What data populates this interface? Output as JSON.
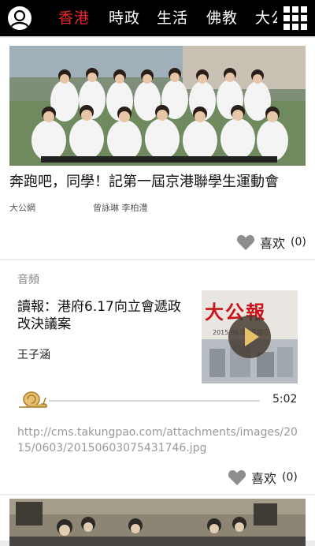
{
  "nav": {
    "tabs": [
      {
        "label": "香港",
        "active": true
      },
      {
        "label": "時政",
        "active": false
      },
      {
        "label": "生活",
        "active": false
      },
      {
        "label": "佛教",
        "active": false
      },
      {
        "label": "大公",
        "active": false
      }
    ],
    "accent_color": "#e8262a"
  },
  "article1": {
    "headline": "奔跑吧，同學！記第一屆京港聯學生運動會",
    "source": "大公網",
    "authors": "曾詠琳 李柏澧",
    "like_label": "喜欢",
    "like_count": "(0)",
    "image_icon": "group-photo"
  },
  "audio_item": {
    "section_label": "音頻",
    "title": "讀報：港府6.17向立會遞政改決議案",
    "author": "王子涵",
    "duration": "5:02",
    "url": "http://cms.takungpao.com/attachments/images/2015/0603/20150603075431746.jpg",
    "like_label": "喜欢",
    "like_count": "(0)",
    "thumbnail": {
      "masthead": "大公報",
      "date_text": "2015.06.03 星期三"
    }
  },
  "article3": {
    "image_icon": "meeting-photo"
  }
}
